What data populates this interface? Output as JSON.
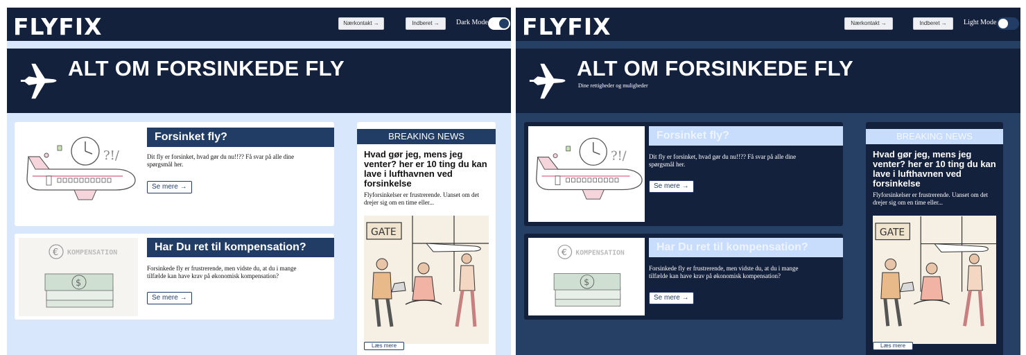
{
  "brand": {
    "logo": "FLYFIX"
  },
  "nav": {
    "contact": "Nærkontakt →",
    "report": "Indberet →"
  },
  "theme": {
    "dark_mode_label": "Dark Mode",
    "light_mode_label": "Light Mode"
  },
  "hero": {
    "title": "ALT OM FORSINKEDE FLY",
    "subtitle": "Dine rettigheder og muligheder"
  },
  "cards": [
    {
      "title": "Forsinket fly?",
      "text": "Dit fly er forsinket, hvad gør du nu!!?? Få svar på alle dine spørgsmål her.",
      "button": "Se mere →"
    },
    {
      "title": "Har Du ret til kompensation?",
      "text": "Forsinkede fly er frustrerende, men vidste du, at du i mange tilfælde kan have krav på økonomisk kompensation?",
      "button": "Se mere →",
      "image_label": "KOMPENSATION"
    }
  ],
  "news": {
    "heading": "BREAKING NEWS",
    "title": "Hvad gør jeg, mens jeg venter? her er 10 ting du kan lave i lufthavnen ved forsinkelse",
    "text": "Flyforsinkelser er frustrerende. Uanset om det drejer sig om en time eller...",
    "image_label": "GATE",
    "button": "Læs mere"
  },
  "colors": {
    "navy": "#14213d",
    "accent": "#213d66",
    "light_bg": "#d8e7fb",
    "dark_bg": "#263f64"
  }
}
